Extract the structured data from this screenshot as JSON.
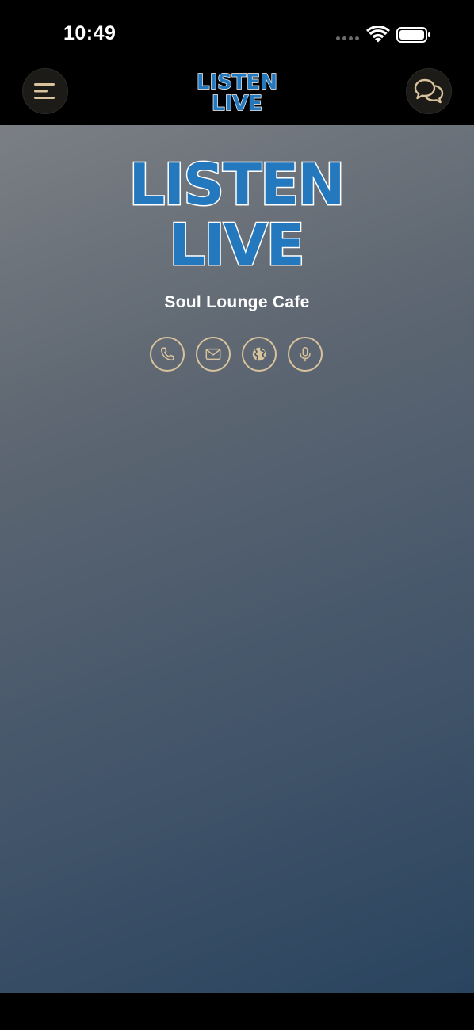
{
  "status_bar": {
    "time": "10:49"
  },
  "header": {
    "logo_line1": "LISTEN",
    "logo_line2": "LIVE",
    "menu_icon": "menu-icon",
    "chat_icon": "chat-bubbles-icon"
  },
  "station": {
    "logo_line1": "LISTEN",
    "logo_line2": "LIVE",
    "name": "Soul Lounge Cafe"
  },
  "actions": [
    {
      "icon": "phone-icon"
    },
    {
      "icon": "mail-icon"
    },
    {
      "icon": "globe-icon"
    },
    {
      "icon": "microphone-icon"
    }
  ],
  "colors": {
    "accent": "#d8c39c",
    "logo_blue": "#1f6fb3",
    "background_top": "#7b7f84",
    "background_bottom": "#2a445f"
  }
}
